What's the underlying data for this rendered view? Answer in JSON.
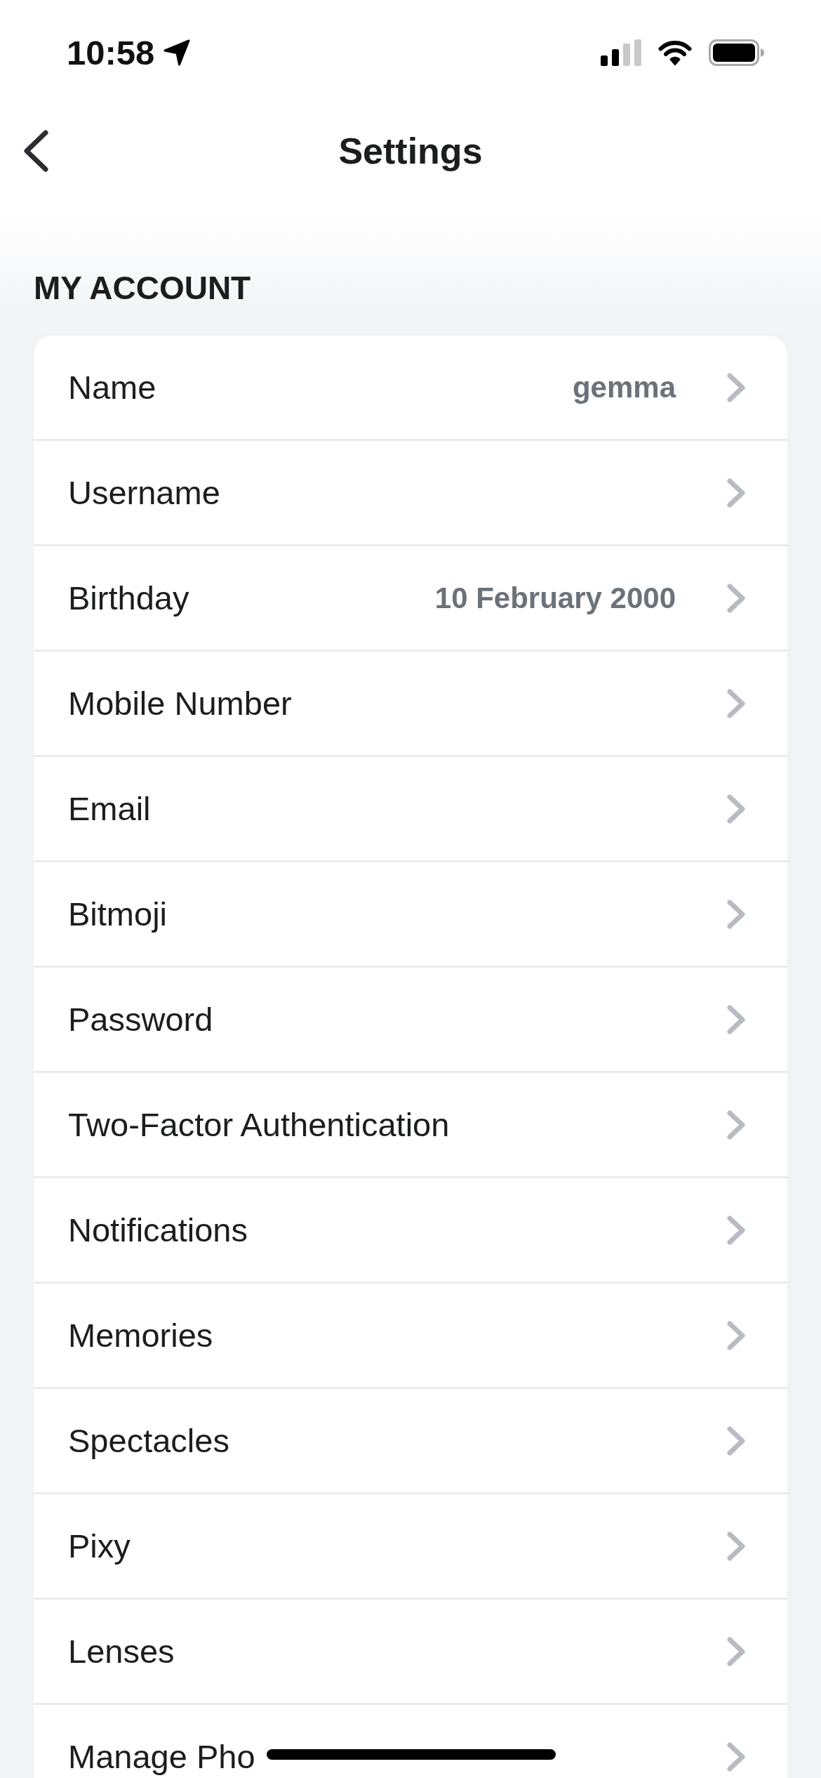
{
  "status_bar": {
    "time": "10:58"
  },
  "header": {
    "title": "Settings"
  },
  "sections": [
    {
      "title": "MY ACCOUNT",
      "items": [
        {
          "label": "Name",
          "value": "gemma"
        },
        {
          "label": "Username"
        },
        {
          "label": "Birthday",
          "value": "10 February 2000"
        },
        {
          "label": "Mobile Number"
        },
        {
          "label": "Email"
        },
        {
          "label": "Bitmoji"
        },
        {
          "label": "Password"
        },
        {
          "label": "Two-Factor Authentication"
        },
        {
          "label": "Notifications"
        },
        {
          "label": "Memories"
        },
        {
          "label": "Spectacles"
        },
        {
          "label": "Pixy"
        },
        {
          "label": "Lenses"
        },
        {
          "label": "Manage Pho"
        }
      ]
    }
  ]
}
